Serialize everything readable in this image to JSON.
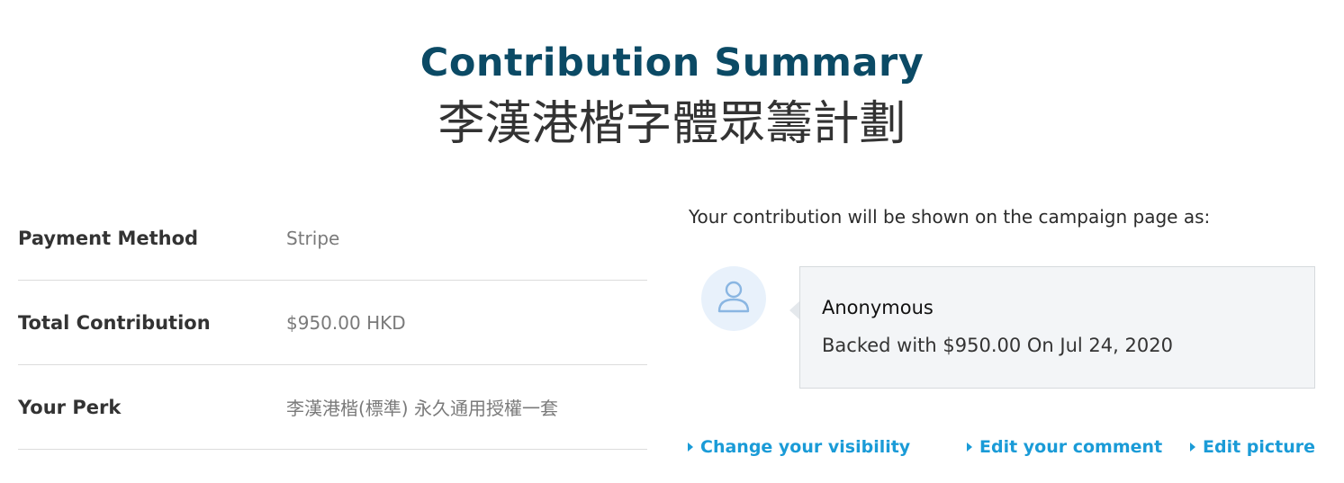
{
  "header": {
    "title": "Contribution Summary",
    "campaign_name": "李漢港楷字體眾籌計劃"
  },
  "summary": {
    "rows": [
      {
        "label": "Payment Method",
        "value": "Stripe"
      },
      {
        "label": "Total Contribution",
        "value": "$950.00 HKD"
      },
      {
        "label": "Your Perk",
        "value": "李漢港楷(標準) 永久通用授權一套"
      }
    ]
  },
  "preview": {
    "heading": "Your contribution will be shown on the campaign page as:",
    "avatar_icon": "user-icon",
    "name": "Anonymous",
    "backed_text": "Backed with $950.00 On Jul 24, 2020"
  },
  "actions": {
    "change_visibility": "Change your visibility",
    "edit_comment": "Edit your comment",
    "edit_picture": "Edit picture"
  },
  "colors": {
    "title": "#0b4a65",
    "link": "#1a9bd7",
    "avatar_bg": "#e8f1fb",
    "avatar_icon": "#8ab6e2"
  }
}
